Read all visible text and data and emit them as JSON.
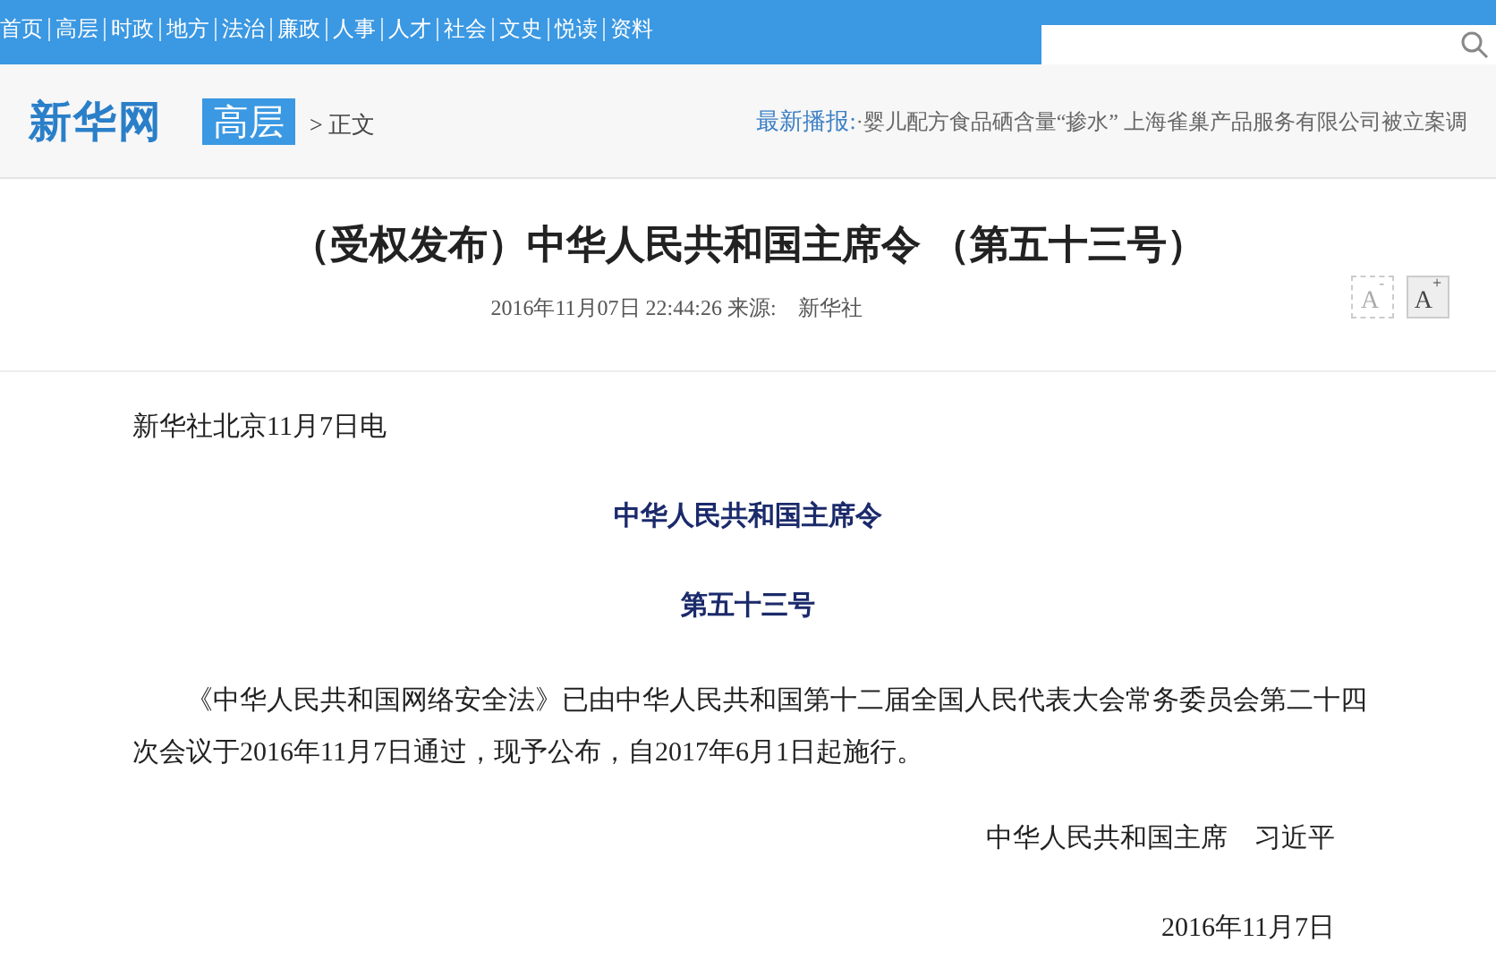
{
  "nav": {
    "items": [
      "首页",
      "高层",
      "时政",
      "地方",
      "法治",
      "廉政",
      "人事",
      "人才",
      "社会",
      "文史",
      "悦读",
      "资料"
    ]
  },
  "header": {
    "logo": "新华网",
    "channel": "高层",
    "breadcrumb": "> 正文",
    "ticker_label": "最新播报:",
    "ticker_text": "·婴儿配方食品硒含量“掺水” 上海雀巢产品服务有限公司被立案调"
  },
  "article": {
    "title": "（受权发布）中华人民共和国主席令 （第五十三号）",
    "meta": "2016年11月07日 22:44:26 来源:　新华社",
    "font_buttons": [
      {
        "label": "A",
        "sup": "-",
        "disabled": true
      },
      {
        "label": "A",
        "sup": "+",
        "disabled": false
      }
    ],
    "body": [
      {
        "kind": "dateline",
        "text": "新华社北京11月7日电"
      },
      {
        "kind": "heading",
        "text": "中华人民共和国主席令"
      },
      {
        "kind": "heading",
        "text": "第五十三号"
      },
      {
        "kind": "paragraph",
        "text": "《中华人民共和国网络安全法》已由中华人民共和国第十二届全国人民代表大会常务委员会第二十四次会议于2016年11月7日通过，现予公布，自2017年6月1日起施行。"
      },
      {
        "kind": "signature",
        "text": "中华人民共和国主席　习近平"
      },
      {
        "kind": "date",
        "text": "2016年11月7日"
      }
    ]
  }
}
